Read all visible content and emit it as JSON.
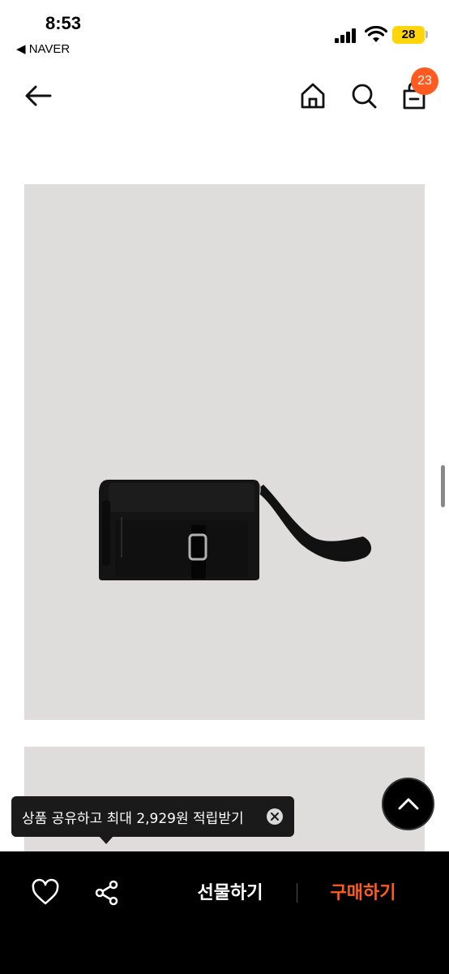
{
  "status_bar": {
    "time": "8:53",
    "back_app": "◀ NAVER",
    "battery": "28"
  },
  "nav": {
    "cart_count": "23"
  },
  "tooltip": {
    "text": "상품 공유하고 최대 2,929원 적립받기"
  },
  "bottom_bar": {
    "gift_label": "선물하기",
    "buy_label": "구매하기"
  },
  "colors": {
    "accent": "#ff5a1f",
    "image_background": "#dedddb",
    "bottom_bar": "#000000"
  },
  "icons": [
    "back-arrow-icon",
    "home-icon",
    "search-icon",
    "cart-icon",
    "heart-icon",
    "share-icon",
    "chevron-up-icon",
    "close-icon"
  ]
}
